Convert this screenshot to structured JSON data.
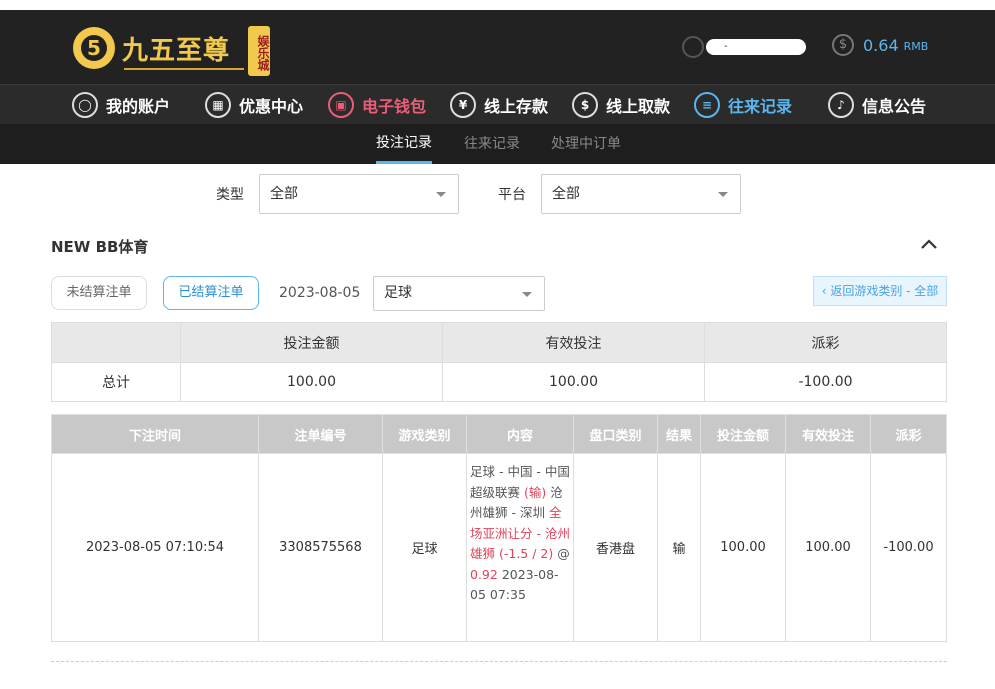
{
  "header": {
    "logo_text": "九五至尊",
    "logo_badge": "娱乐城",
    "username": "-",
    "balance": "0.64",
    "currency": "RMB"
  },
  "nav": [
    {
      "label": "我的账户",
      "icon": "user-icon"
    },
    {
      "label": "优惠中心",
      "icon": "gift-icon"
    },
    {
      "label": "电子钱包",
      "icon": "wallet-icon"
    },
    {
      "label": "线上存款",
      "icon": "deposit-icon"
    },
    {
      "label": "线上取款",
      "icon": "withdraw-icon"
    },
    {
      "label": "往来记录",
      "icon": "record-icon"
    },
    {
      "label": "信息公告",
      "icon": "bell-icon"
    }
  ],
  "subnav": [
    "投注记录",
    "往来记录",
    "处理中订单"
  ],
  "filters": {
    "type_label": "类型",
    "type_value": "全部",
    "platform_label": "平台",
    "platform_value": "全部"
  },
  "section": {
    "title": "NEW BB体育",
    "unsettled": "未结算注单",
    "settled": "已结算注单",
    "date": "2023-08-05",
    "sport": "足球",
    "back": "‹ 返回游戏类别 - 全部"
  },
  "summary": {
    "headers": [
      "",
      "投注金额",
      "有效投注",
      "派彩"
    ],
    "row": [
      "总计",
      "100.00",
      "100.00",
      "-100.00"
    ]
  },
  "detail": {
    "headers": [
      "下注时间",
      "注单编号",
      "游戏类别",
      "内容",
      "盘口类别",
      "结果",
      "投注金额",
      "有效投注",
      "派彩"
    ],
    "row": {
      "time": "2023-08-05 07:10:54",
      "id": "3308575568",
      "game": "足球",
      "content_1": "足球 - 中国 - 中国超级联赛 ",
      "content_1_red": "(输)",
      "content_2": " 沧州雄狮 - 深圳 ",
      "content_3_red": "全场亚洲让分 - 沧州雄狮 (-1.5 / 2)",
      "content_4": " @ ",
      "content_4_red": "0.92",
      "content_5": " 2023-08-05 07:35",
      "market": "香港盘",
      "result": "输",
      "stake": "100.00",
      "valid": "100.00",
      "payout": "-100.00"
    }
  },
  "colors": {
    "accent": "#5bb5ef",
    "negative": "#e0435c",
    "wallet": "#ec5d7a",
    "gold": "#f2c94c"
  }
}
